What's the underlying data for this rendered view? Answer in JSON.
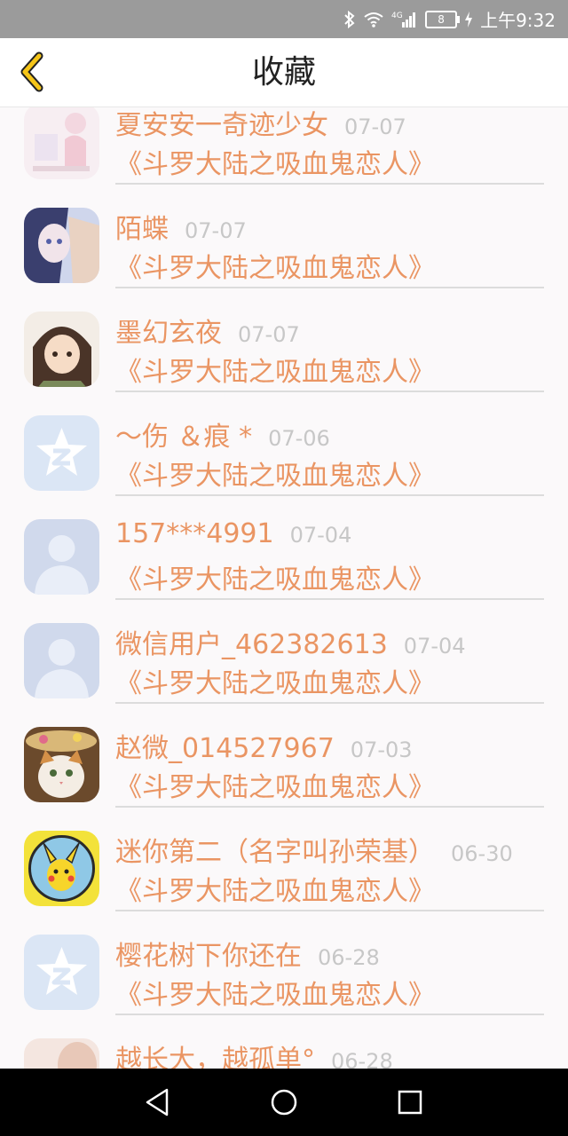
{
  "status_bar": {
    "time": "上午9:32",
    "network": "4G",
    "battery_level": "8",
    "icons": [
      "bluetooth-icon",
      "wifi-icon",
      "signal-icon",
      "battery-icon",
      "charging-icon"
    ]
  },
  "header": {
    "title": "收藏",
    "back_icon": "chevron-left-icon",
    "accent_color": "#f5c518"
  },
  "colors": {
    "name_color": "#ea9563",
    "date_color": "#c7c7c7",
    "divider": "#dcdcdc"
  },
  "items": [
    {
      "name": "夏安安一奇迹少女",
      "date": "07-07",
      "title": "《斗罗大陆之吸血鬼恋人》",
      "avatar": "illustration-avatar"
    },
    {
      "name": "陌蝶",
      "date": "07-07",
      "title": "《斗罗大陆之吸血鬼恋人》",
      "avatar": "anime-girl-avatar"
    },
    {
      "name": "墨幻玄夜",
      "date": "07-07",
      "title": "《斗罗大陆之吸血鬼恋人》",
      "avatar": "chibi-avatar"
    },
    {
      "name": "～伤 ＆痕 *",
      "date": "07-06",
      "title": "《斗罗大陆之吸血鬼恋人》",
      "avatar": "qq-star-avatar"
    },
    {
      "name": "157***4991",
      "date": "07-04",
      "title": "《斗罗大陆之吸血鬼恋人》",
      "avatar": "default-person-avatar"
    },
    {
      "name": "微信用户_462382613",
      "date": "07-04",
      "title": "《斗罗大陆之吸血鬼恋人》",
      "avatar": "default-person-avatar"
    },
    {
      "name": "赵微_014527967",
      "date": "07-03",
      "title": "《斗罗大陆之吸血鬼恋人》",
      "avatar": "kitten-avatar"
    },
    {
      "name": "迷你第二（名字叫孙荣基）",
      "date": "06-30",
      "title": "《斗罗大陆之吸血鬼恋人》",
      "avatar": "pikachu-avatar"
    },
    {
      "name": "樱花树下你还在",
      "date": "06-28",
      "title": "《斗罗大陆之吸血鬼恋人》",
      "avatar": "qq-star-avatar"
    },
    {
      "name": "越长大，越孤单°",
      "date": "06-28",
      "title": "",
      "avatar": "photo-avatar"
    }
  ],
  "nav_bar": {
    "back": "triangle-back-icon",
    "home": "circle-home-icon",
    "recents": "square-recents-icon"
  }
}
